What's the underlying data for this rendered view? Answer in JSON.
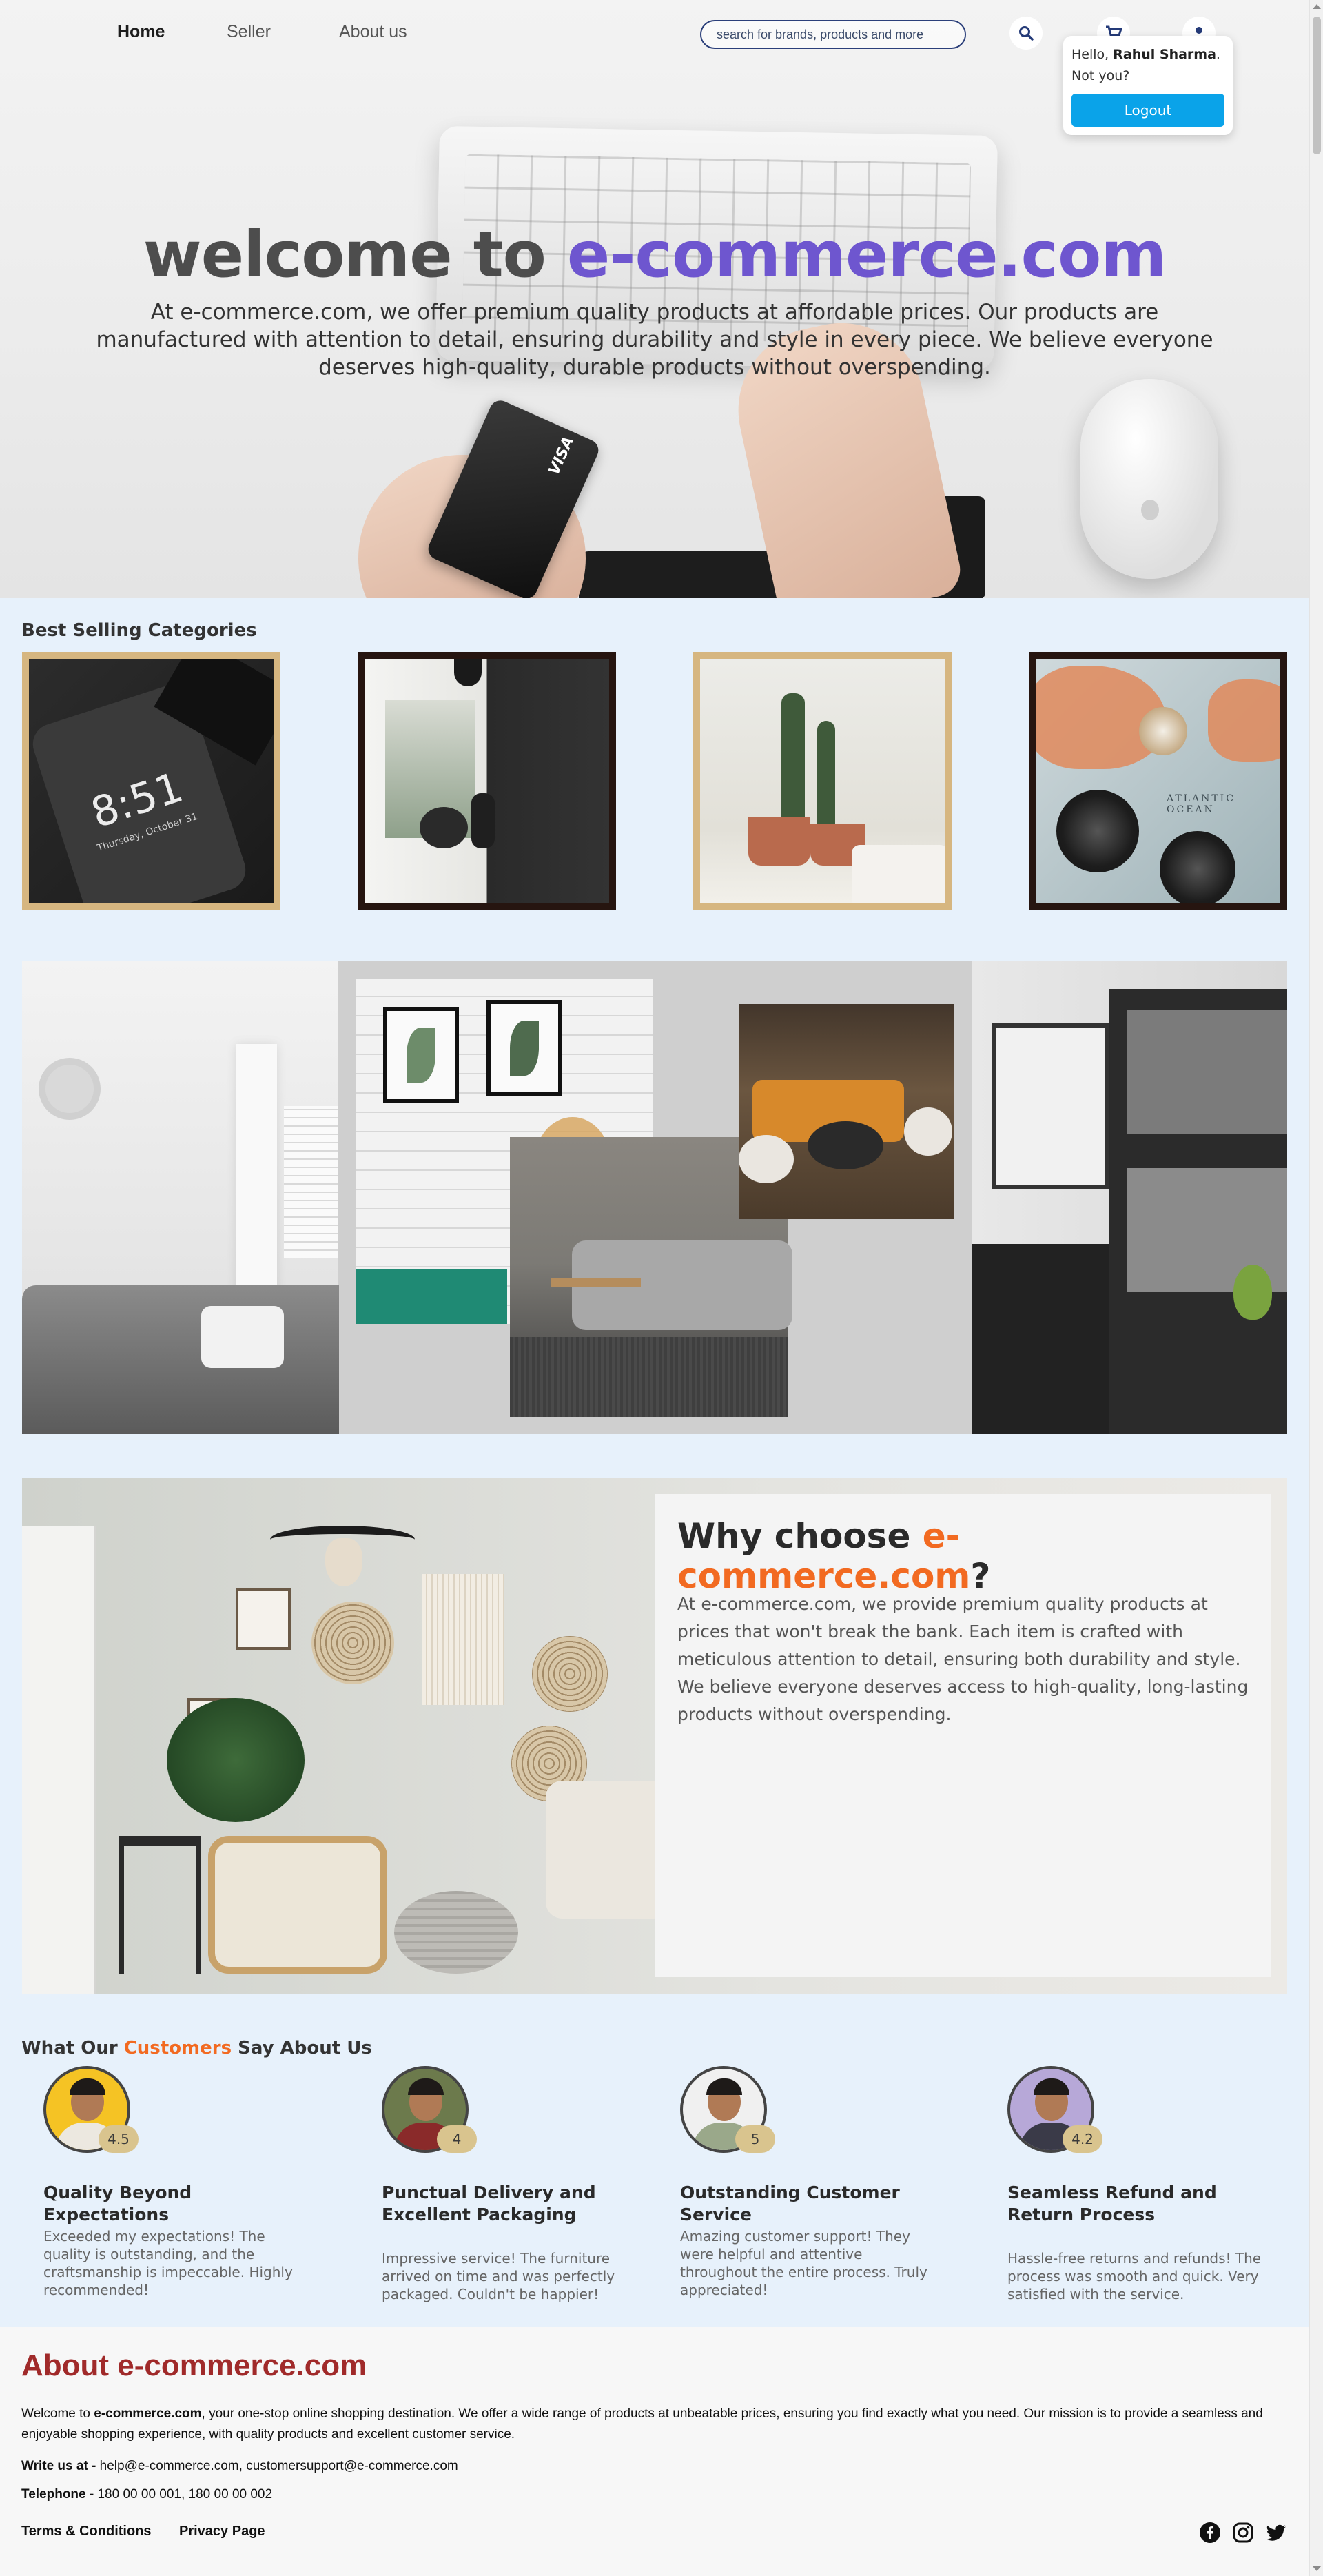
{
  "nav": {
    "links": [
      "Home",
      "Seller",
      "About us"
    ],
    "search_placeholder": "search for brands, products and more"
  },
  "user_popup": {
    "greeting": "Hello, ",
    "name": "Rahul Sharma",
    "after_name": ".",
    "not_you": "Not you?",
    "logout_label": "Logout"
  },
  "hero": {
    "title_prefix": "welcome to ",
    "title_brand": "e-commerce.com",
    "description": "At e-commerce.com, we offer premium quality products at affordable prices. Our products are manufactured with attention to detail, ensuring durability and style in every piece. We believe everyone deserves high-quality, durable products without overspending.",
    "card_brand": "VISA"
  },
  "categories": {
    "title": "Best Selling Categories",
    "phone_time": "8:51",
    "phone_date": "Thursday, October 31",
    "map_label": "ATLANTIC OCEAN"
  },
  "why": {
    "title_prefix": "Why choose ",
    "title_brand": "e-commerce.com",
    "title_suffix": "?",
    "body": "At e-commerce.com, we provide premium quality products at prices that won't break the bank. Each item is crafted with meticulous attention to detail, ensuring both durability and style. We believe everyone deserves access to high-quality, long-lasting products without overspending."
  },
  "testimonials": {
    "title_prefix": "What Our ",
    "title_highlight": "Customers",
    "title_suffix": " Say About Us",
    "items": [
      {
        "rating": "4.5",
        "title": "Quality Beyond Expectations",
        "body": "Exceeded my expectations! The quality is outstanding, and the craftsmanship is impeccable. Highly recommended!"
      },
      {
        "rating": "4",
        "title": "Punctual Delivery and Excellent Packaging",
        "body": "Impressive service! The furniture arrived on time and was perfectly packaged. Couldn't be happier!"
      },
      {
        "rating": "5",
        "title": "Outstanding Customer Service",
        "body": "Amazing customer support! They were helpful and attentive throughout the entire process. Truly appreciated!"
      },
      {
        "rating": "4.2",
        "title": "Seamless Refund and Return Process",
        "body": "Hassle-free returns and refunds! The process was smooth and quick. Very satisfied with the service."
      }
    ]
  },
  "footer": {
    "about_title": "About e-commerce.com",
    "about_intro": "Welcome to ",
    "about_brand": "e-commerce.com",
    "about_rest": ", your one-stop online shopping destination. We offer a wide range of products at unbeatable prices, ensuring you find exactly what you need. Our mission is to provide a seamless and enjoyable shopping experience, with quality products and excellent customer service.",
    "write_label": "Write us at - ",
    "write_value": "help@e-commerce.com, customersupport@e-commerce.com",
    "phone_label": "Telephone - ",
    "phone_value": "180 00 00 001, 180 00 00 002",
    "links": [
      "Terms & Conditions",
      "Privacy Page"
    ],
    "social_icons": [
      "facebook-icon",
      "instagram-icon",
      "twitter-icon"
    ]
  },
  "colors": {
    "brand_purple": "#6e56cf",
    "accent_orange": "#f26a21",
    "logout_blue": "#0aa3e9",
    "about_red": "#a02a2a",
    "page_bg": "#e7f1fb",
    "frame_gold": "#d6b680",
    "frame_dark": "#261510"
  }
}
